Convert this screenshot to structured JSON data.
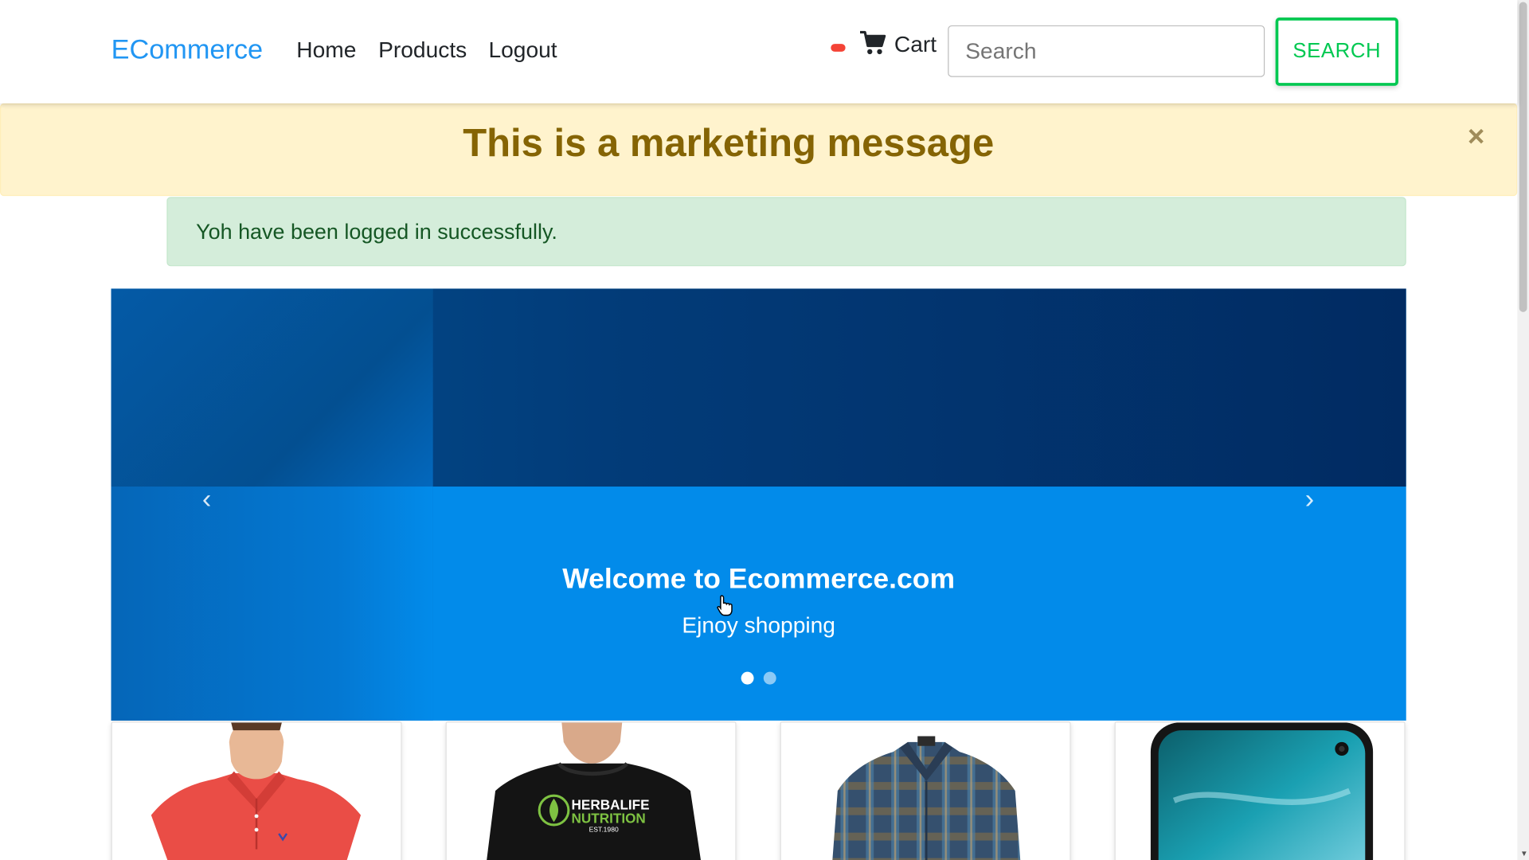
{
  "navbar": {
    "brand": "ECommerce",
    "links": [
      "Home",
      "Products",
      "Logout"
    ],
    "cart_label": "Cart",
    "search_placeholder": "Search",
    "search_button": "SEARCH"
  },
  "marketing": {
    "message": "This is a marketing message",
    "close": "×"
  },
  "alert": {
    "message": "Yoh have been logged in successfully."
  },
  "carousel": {
    "title": "Welcome to Ecommerce.com",
    "subtitle": "Ejnoy shopping",
    "prev": "‹",
    "next": "›",
    "slides": 2,
    "active_slide": 1
  },
  "products": [
    {
      "image": "red-polo-shirt"
    },
    {
      "image": "black-herbalife-tshirt",
      "print_line1": "HERBALIFE",
      "print_line2": "NUTRITION",
      "print_line3": "EST.1980"
    },
    {
      "image": "plaid-flannel-shirt"
    },
    {
      "image": "smartphone"
    }
  ],
  "colors": {
    "brand": "#2196f3",
    "success_button": "#00c851",
    "marketing_text": "#856404",
    "alert_text": "#155724",
    "carousel_blue": "#028bea"
  }
}
